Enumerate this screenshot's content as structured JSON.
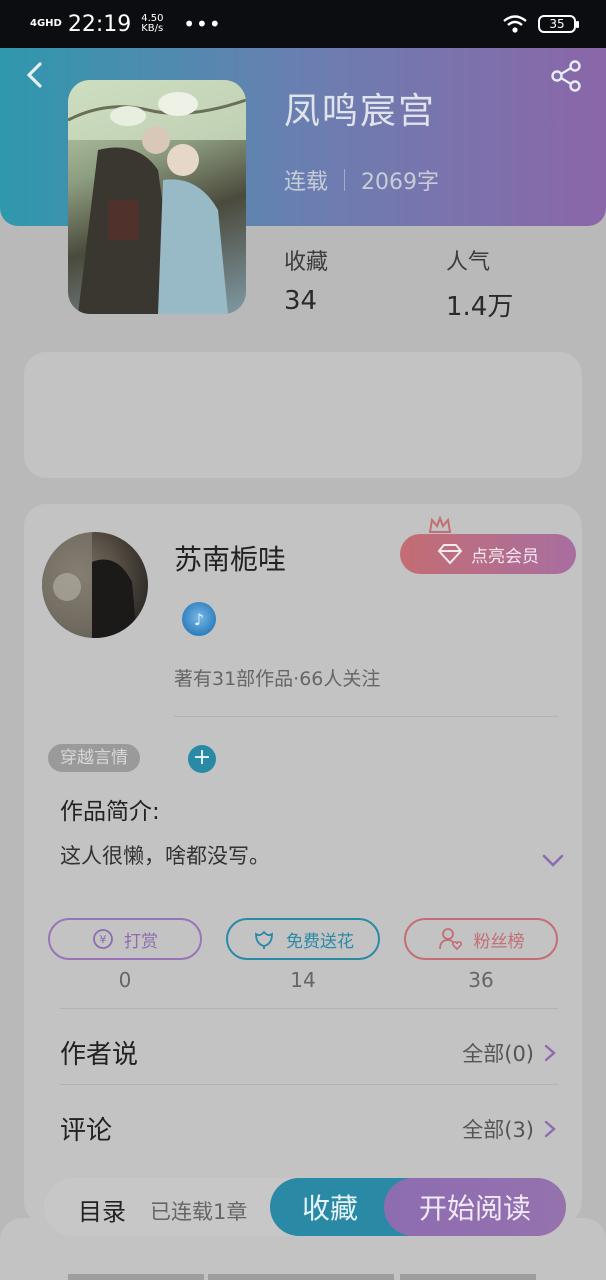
{
  "status_bar": {
    "network": "4GHD",
    "time": "22:19",
    "speed_value": "4.50",
    "speed_unit": "KB/s",
    "more": "•••",
    "battery": "35"
  },
  "book": {
    "title": "凤鸣宸宫",
    "status": "连载",
    "word_count": "2069字",
    "stats": [
      {
        "label": "收藏",
        "value": "34"
      },
      {
        "label": "人气",
        "value": "1.4万"
      }
    ]
  },
  "author": {
    "name": "苏南栀哇",
    "summary": "著有31部作品·66人关注",
    "vip_label": "点亮会员"
  },
  "tags": [
    "穿越言情"
  ],
  "intro": {
    "label": "作品简介:",
    "text": "这人很懒，啥都没写。"
  },
  "actions": [
    {
      "label": "打赏",
      "count": "0"
    },
    {
      "label": "免费送花",
      "count": "14"
    },
    {
      "label": "粉丝榜",
      "count": "36"
    }
  ],
  "sections": {
    "author_says": {
      "title": "作者说",
      "link": "全部(0)"
    },
    "comments": {
      "title": "评论",
      "link": "全部(3)"
    }
  },
  "bottom": {
    "toc": "目录",
    "toc_sub": "已连载1章",
    "favorite": "收藏",
    "read": "开始阅读"
  },
  "colors": {
    "accent_teal": "#2a8aa6",
    "accent_purple": "#8d6cb0",
    "vip_pink": "#c46d73"
  }
}
